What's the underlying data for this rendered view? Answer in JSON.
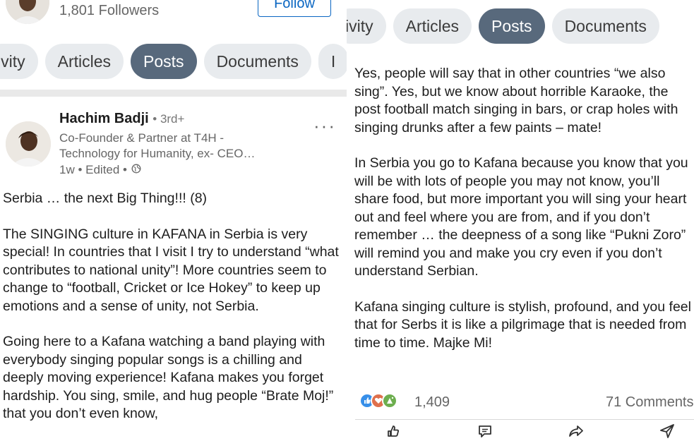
{
  "left": {
    "followers": "1,801 Followers",
    "follow_label": "Follow",
    "tabs": [
      "ivity",
      "Articles",
      "Posts",
      "Documents",
      "I"
    ],
    "author": {
      "name": "Hachim Badji",
      "degree": "• 3rd+",
      "headline_1": "Co-Founder & Partner at T4H -",
      "headline_2": "Technology for Humanity, ex- CEO…",
      "meta": "1w • Edited •"
    },
    "more_label": "···",
    "paragraphs": [
      "Serbia … the next Big Thing!!! (8)",
      "The SINGING culture in KAFANA in Serbia is very special! In countries that I visit I try to understand “what contributes to national unity”! More countries seem to change to “football, Cricket or Ice Hokey” to keep up emotions and a sense of unity, not Serbia.",
      "Going here to a Kafana watching a band playing with everybody singing popular songs is a chilling and deeply moving experience! Kafana makes you forget hardship. You sing, smile, and hug people “Brate Moj!” that you don’t even know,"
    ]
  },
  "right": {
    "tabs": [
      "ivity",
      "Articles",
      "Posts",
      "Documents"
    ],
    "paragraphs": [
      "Yes, people will say that in other countries “we also sing”. Yes, but we know about horrible Karaoke, the post football match singing in bars, or crap holes with singing drunks after a few paints – mate!",
      "In Serbia you go to Kafana because you know that you will be with lots of people you may not know, you’ll share food, but more important you will sing your heart out and feel where you are from, and if you don’t remember … the deepness of a song like “Pukni Zoro” will remind you and make you cry even if you don’t understand Serbian.",
      "Kafana singing culture is stylish, profound, and you feel that for Serbs it is like a pilgrimage that is needed from time to time. Majke Mi!"
    ],
    "reaction_count": "1,409",
    "comments": "71 Comments",
    "reaction_icons": [
      "like-icon",
      "love-icon",
      "celebrate-icon"
    ],
    "actions": [
      "like-icon",
      "comment-icon",
      "share-icon",
      "send-icon"
    ]
  },
  "colors": {
    "accent": "#0a66c2",
    "tab_active": "#58697c",
    "tab_bg": "#e8ebee",
    "like": "#378fe9",
    "love": "#df704d",
    "celebrate": "#6dae4f"
  }
}
